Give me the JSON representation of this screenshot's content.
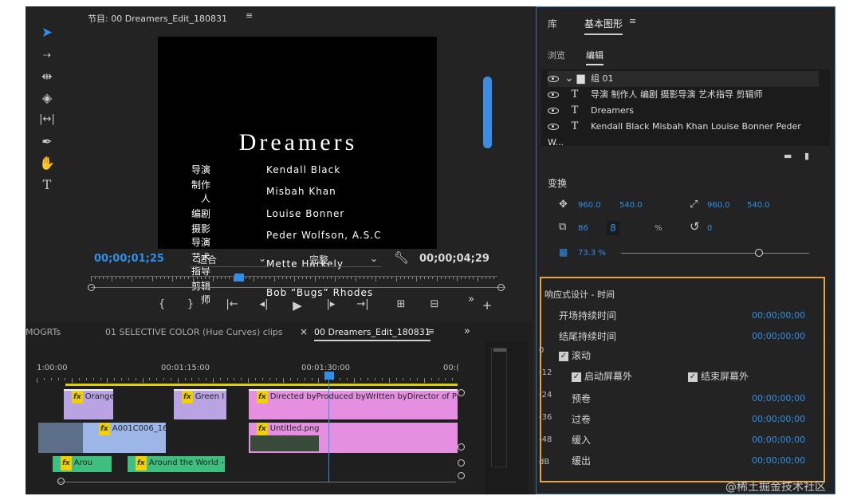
{
  "monitor": {
    "title": "节目: 00 Dreamers_Edit_180831",
    "credits_title": "Dreamers",
    "credits": [
      {
        "role": "导演",
        "name": "Kendall Black"
      },
      {
        "role": "制作人",
        "name": "Misbah Khan"
      },
      {
        "role": "编剧",
        "name": "Louise Bonner"
      },
      {
        "role": "摄影导演",
        "name": "Peder Wolfson, A.S.C"
      },
      {
        "role": "艺术指导",
        "name": "Mette Harkely"
      },
      {
        "role": "剪辑师",
        "name": "Bob “Bugs” Rhodes"
      }
    ],
    "current_timecode": "00;00;01;25",
    "fit_select": "适合",
    "quality_select": "完整",
    "duration_timecode": "00;00;04;29"
  },
  "right_panel": {
    "tab_library": "库",
    "tab_essential_graphics": "基本图形",
    "sub_browse": "浏览",
    "sub_edit": "编辑",
    "layers": [
      {
        "type": "group",
        "label": "组 01"
      },
      {
        "type": "text",
        "label": "导演 制作人 编剧 摄影导演 艺术指导 剪辑师"
      },
      {
        "type": "text",
        "label": "Dreamers"
      },
      {
        "type": "text",
        "label": "Kendall Black Misbah Khan Louise Bonner Peder W..."
      }
    ],
    "transform": {
      "heading": "变换",
      "pos_x": "960.0",
      "pos_y": "540.0",
      "anchor_x": "960.0",
      "anchor_y": "540.0",
      "scale": "86",
      "scale_unit": "%",
      "rotation": "0",
      "opacity": "73.3 %",
      "opacity_fraction": 0.733
    },
    "responsive": {
      "heading": "响应式设计 - 时间",
      "intro_label": "开场持续时间",
      "intro_value": "00;00;00;00",
      "outro_label": "结尾持续时间",
      "outro_value": "00;00;00;00",
      "roll_label": "滚动",
      "start_off_label": "启动屏幕外",
      "end_off_label": "结束屏幕外",
      "preroll_label": "预卷",
      "preroll_value": "00;00;00;00",
      "postroll_label": "过卷",
      "postroll_value": "00;00;00;00",
      "ease_in_label": "缓入",
      "ease_in_value": "00;00;00;00",
      "ease_out_label": "缓出",
      "ease_out_value": "00;00;00;00"
    }
  },
  "timeline": {
    "tab_mogrts": "MOGRTs",
    "tab_selective": "01 SELECTIVE COLOR (Hue Curves) clips",
    "tab_close": "×",
    "tab_active": "00 Dreamers_Edit_180831",
    "ruler": [
      "1:00:00",
      "00:01:15:00",
      "00:01:30:00",
      "00:("
    ],
    "clips": {
      "orange": "Orange",
      "green": "Green I",
      "credits": "Directed byProduced byWritten byDirector of Photograp",
      "video_a": "A001C006_16(",
      "untitled": "Untitled.png",
      "around_short": "Arou",
      "around_full": "Around the World - Sc"
    }
  },
  "meter": {
    "labels": [
      "0",
      "-12",
      "-24",
      "-36",
      "-48",
      "dB"
    ]
  },
  "watermark": "@稀土掘金技术社区",
  "colors": {
    "accent": "#2f8fea",
    "selection_border": "#e8a33a",
    "graphic_clip": "#e58fe0",
    "video_clip": "#9db6e8",
    "audio_clip": "#3fbf7f"
  }
}
